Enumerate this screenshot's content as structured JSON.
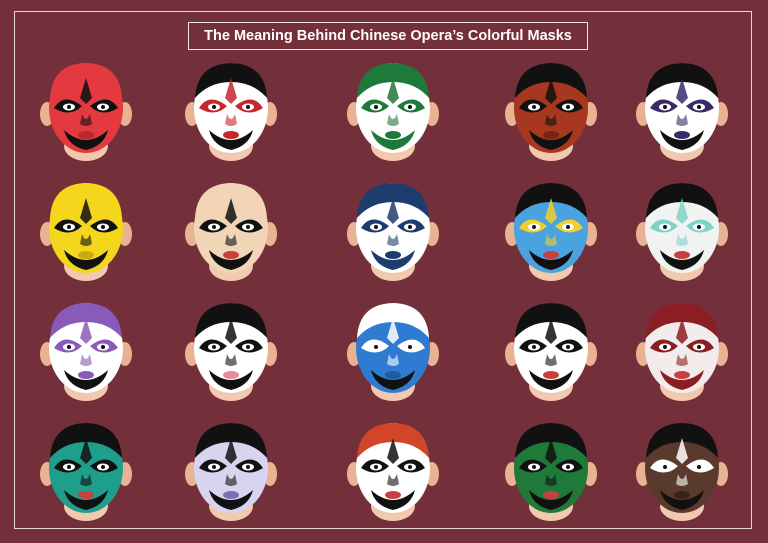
{
  "title": "The Meaning Behind Chinese Opera’s Colorful Masks",
  "colors": {
    "background": "#74303a",
    "frame": "#e9d6d9",
    "skin": "#f2c9ae",
    "ear": "#e7b393"
  },
  "masks": [
    {
      "name": "red-yinyang-mask",
      "face": "#e43a3f",
      "accent": "#111111",
      "hair": "#e43a3f",
      "beard": "#111111",
      "mouth": "#b8282c"
    },
    {
      "name": "white-red-brow-mask",
      "face": "#ffffff",
      "accent": "#c6262d",
      "hair": "#111111",
      "beard": "#111111",
      "mouth": "#c6262d"
    },
    {
      "name": "green-white-mask",
      "face": "#ffffff",
      "accent": "#1e7a3a",
      "hair": "#1e7a3a",
      "beard": "#1e7a3a",
      "mouth": "#1e7a3a"
    },
    {
      "name": "brown-red-mask",
      "face": "#a8371f",
      "accent": "#111111",
      "hair": "#111111",
      "beard": "#111111",
      "mouth": "#7c2212"
    },
    {
      "name": "white-purple-line-mask",
      "face": "#ffffff",
      "accent": "#3b2a6b",
      "hair": "#111111",
      "beard": "#111111",
      "mouth": "#3b2a6b"
    },
    {
      "name": "yellow-mask",
      "face": "#f4d61c",
      "accent": "#111111",
      "hair": "#f4d61c",
      "beard": "#111111",
      "mouth": "#c9a911"
    },
    {
      "name": "clown-mask",
      "face": "#f1d5b6",
      "accent": "#111111",
      "hair": "#f1d5b6",
      "beard": "#111111",
      "mouth": "#c9413e"
    },
    {
      "name": "navy-swirl-mask",
      "face": "#ffffff",
      "accent": "#1e3d6e",
      "hair": "#1e3d6e",
      "beard": "#1e3d6e",
      "mouth": "#1e3d6e"
    },
    {
      "name": "sky-blue-gold-mask",
      "face": "#4aa3df",
      "accent": "#f2cf2c",
      "hair": "#111111",
      "beard": "#111111",
      "mouth": "#c9413e"
    },
    {
      "name": "white-teal-stripe-mask",
      "face": "#f0f3f1",
      "accent": "#7fd2c6",
      "hair": "#111111",
      "beard": "#111111",
      "mouth": "#c9413e"
    },
    {
      "name": "purple-mask",
      "face": "#ffffff",
      "accent": "#8a5ab8",
      "hair": "#8a5ab8",
      "beard": "#111111",
      "mouth": "#8a5ab8"
    },
    {
      "name": "pink-black-mask",
      "face": "#ffffff",
      "accent": "#111111",
      "hair": "#111111",
      "beard": "#111111",
      "mouth": "#e78aa0"
    },
    {
      "name": "blue-mask",
      "face": "#2f7bd1",
      "accent": "#ffffff",
      "hair": "#ffffff",
      "beard": "#111111",
      "mouth": "#1f5aa3"
    },
    {
      "name": "white-pink-stripe-mask",
      "face": "#ffffff",
      "accent": "#111111",
      "hair": "#111111",
      "beard": "#111111",
      "mouth": "#c9413e"
    },
    {
      "name": "white-red-hair-mask",
      "face": "#f3ecec",
      "accent": "#8b1e22",
      "hair": "#8b1e22",
      "beard": "#8b1e22",
      "mouth": "#c9413e"
    },
    {
      "name": "teal-yinyang-mask",
      "face": "#1f9e8b",
      "accent": "#111111",
      "hair": "#111111",
      "beard": "#111111",
      "mouth": "#c9413e"
    },
    {
      "name": "lavender-mask",
      "face": "#d8d4f0",
      "accent": "#111111",
      "hair": "#111111",
      "beard": "#111111",
      "mouth": "#7f6db6"
    },
    {
      "name": "ornate-black-mask",
      "face": "#ffffff",
      "accent": "#111111",
      "hair": "#d1452a",
      "beard": "#111111",
      "mouth": "#c9413e"
    },
    {
      "name": "dark-green-mask",
      "face": "#1f7a3a",
      "accent": "#111111",
      "hair": "#111111",
      "beard": "#111111",
      "mouth": "#c9413e"
    },
    {
      "name": "dark-brown-mask",
      "face": "#5b3a2e",
      "accent": "#ffffff",
      "hair": "#111111",
      "beard": "#111111",
      "mouth": "#3a221a"
    }
  ]
}
